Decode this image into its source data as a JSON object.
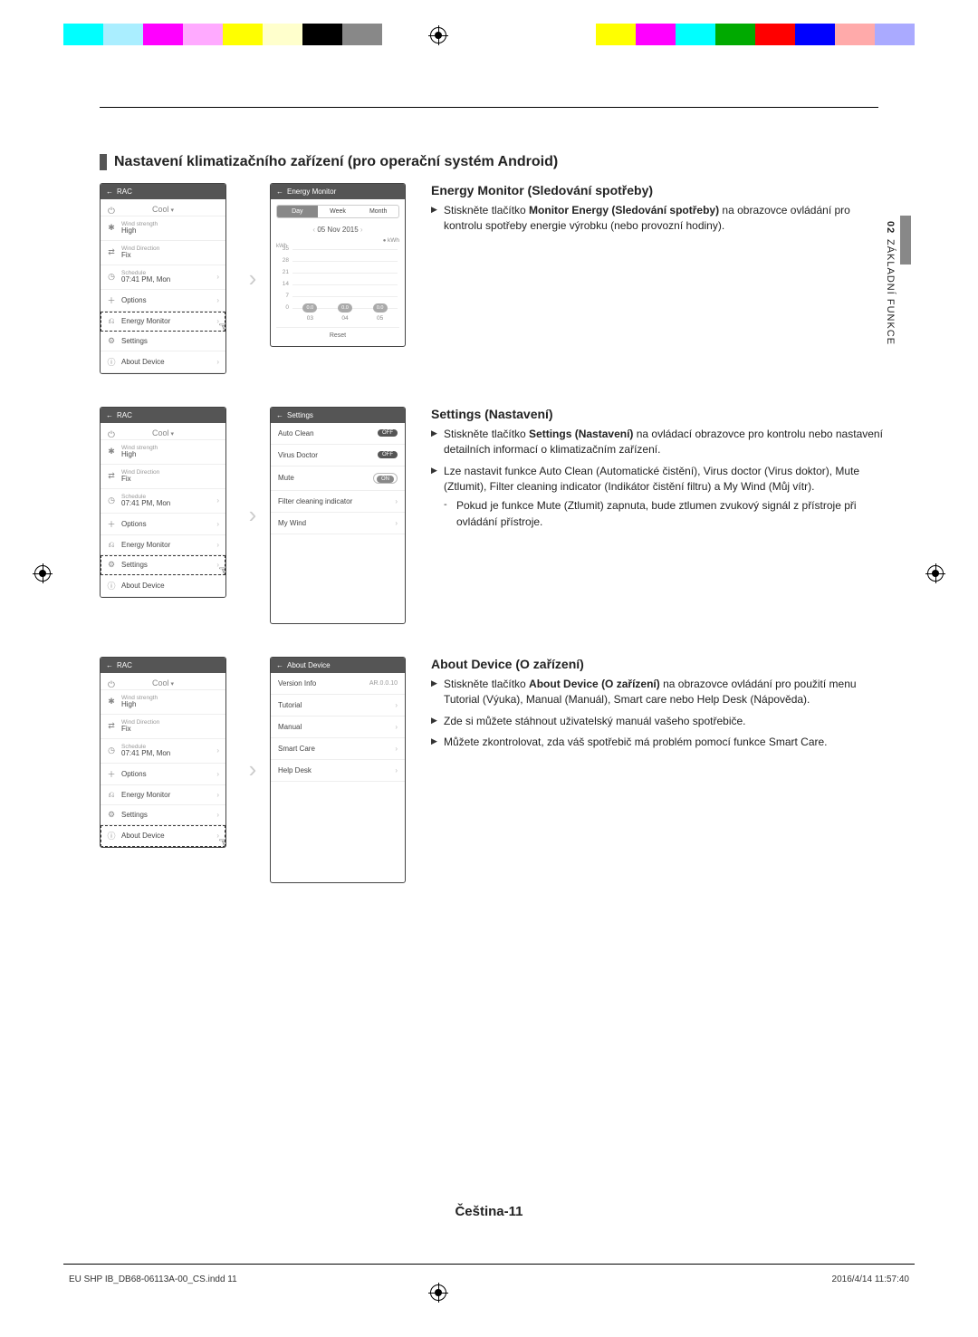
{
  "meta": {
    "section_title": "Nastavení klimatizačního zařízení (pro operační systém Android)",
    "page_label": "Čeština-11",
    "side_tab_num": "02",
    "side_tab_text": "ZÁKLADNÍ FUNKCE",
    "footer_left": "EU SHP IB_DB68-06113A-00_CS.indd   11",
    "footer_right": "2016/4/14   11:57:40"
  },
  "rac_screen": {
    "header": "RAC",
    "mode": "Cool",
    "rows": {
      "wind_strength": {
        "sub": "Wind strength",
        "val": "High"
      },
      "wind_direction": {
        "sub": "Wind Direction",
        "val": "Fix"
      },
      "schedule": {
        "sub": "Schedule",
        "val": "07:41 PM, Mon"
      },
      "options": "Options",
      "energy_monitor": "Energy Monitor",
      "settings": "Settings",
      "about_device": "About Device"
    },
    "icons": {
      "power": "⏻",
      "fan": "✱",
      "direction": "⇄",
      "clock": "◷",
      "plus": "＋",
      "monitor": "⎌",
      "gear": "⚙",
      "info": "ⓘ"
    }
  },
  "energy_monitor": {
    "heading": "Energy Monitor (Sledování spotřeby)",
    "panel_header": "Energy Monitor",
    "tabs": {
      "day": "Day",
      "week": "Week",
      "month": "Month"
    },
    "date": "05 Nov 2015",
    "unit": "kWh",
    "y_axis_label": "kWh",
    "reset": "Reset",
    "bullets": [
      "Stiskněte tlačítko <b>Monitor Energy (Sledování spotřeby)</b> na obrazovce ovládání pro kontrolu spotřeby energie výrobku (nebo provozní hodiny)."
    ]
  },
  "chart_data": {
    "type": "bar",
    "categories": [
      "03",
      "04",
      "05"
    ],
    "values": [
      0.0,
      0.0,
      0.0
    ],
    "value_labels": [
      "0.0",
      "0.0",
      "0.0"
    ],
    "y_ticks": [
      0,
      7,
      14,
      21,
      28,
      35
    ],
    "ylim": [
      0,
      35
    ],
    "ylabel": "kWh",
    "xlabel": "",
    "title": ""
  },
  "settings": {
    "heading": "Settings (Nastavení)",
    "panel_header": "Settings",
    "rows": {
      "auto_clean": {
        "label": "Auto Clean",
        "state": "OFF"
      },
      "virus_doctor": {
        "label": "Virus Doctor",
        "state": "OFF"
      },
      "mute": {
        "label": "Mute",
        "state": "ON"
      },
      "filter": {
        "label": "Filter cleaning indicator"
      },
      "my_wind": {
        "label": "My Wind"
      }
    },
    "bullets": [
      "Stiskněte tlačítko <b>Settings (Nastavení)</b> na ovládací obrazovce pro kontrolu nebo nastavení detailních informací o klimatizačním zařízení.",
      "Lze nastavit funkce Auto Clean (Automatické čistění), Virus doctor (Virus doktor), Mute (Ztlumit), Filter cleaning indicator (Indikátor čistění filtru) a My Wind (Můj vítr)."
    ],
    "sub_bullet": "Pokud je funkce Mute (Ztlumit) zapnuta, bude ztlumen zvukový signál z přístroje při ovládání přístroje."
  },
  "about": {
    "heading": "About Device (O zařízení)",
    "panel_header": "About Device",
    "rows": {
      "version": {
        "label": "Version Info",
        "val": "AR.0.0.10"
      },
      "tutorial": "Tutorial",
      "manual": "Manual",
      "smart_care": "Smart Care",
      "help_desk": "Help Desk"
    },
    "bullets": [
      "Stiskněte tlačítko <b>About Device (O zařízení)</b> na obrazovce ovládání pro použití menu Tutorial (Výuka), Manual (Manuál), Smart care nebo Help Desk (Nápověda).",
      "Zde si můžete stáhnout uživatelský manuál vašeho spotřebiče.",
      "Můžete zkontrolovat, zda váš spotřebič má problém pomocí funkce Smart Care."
    ]
  }
}
